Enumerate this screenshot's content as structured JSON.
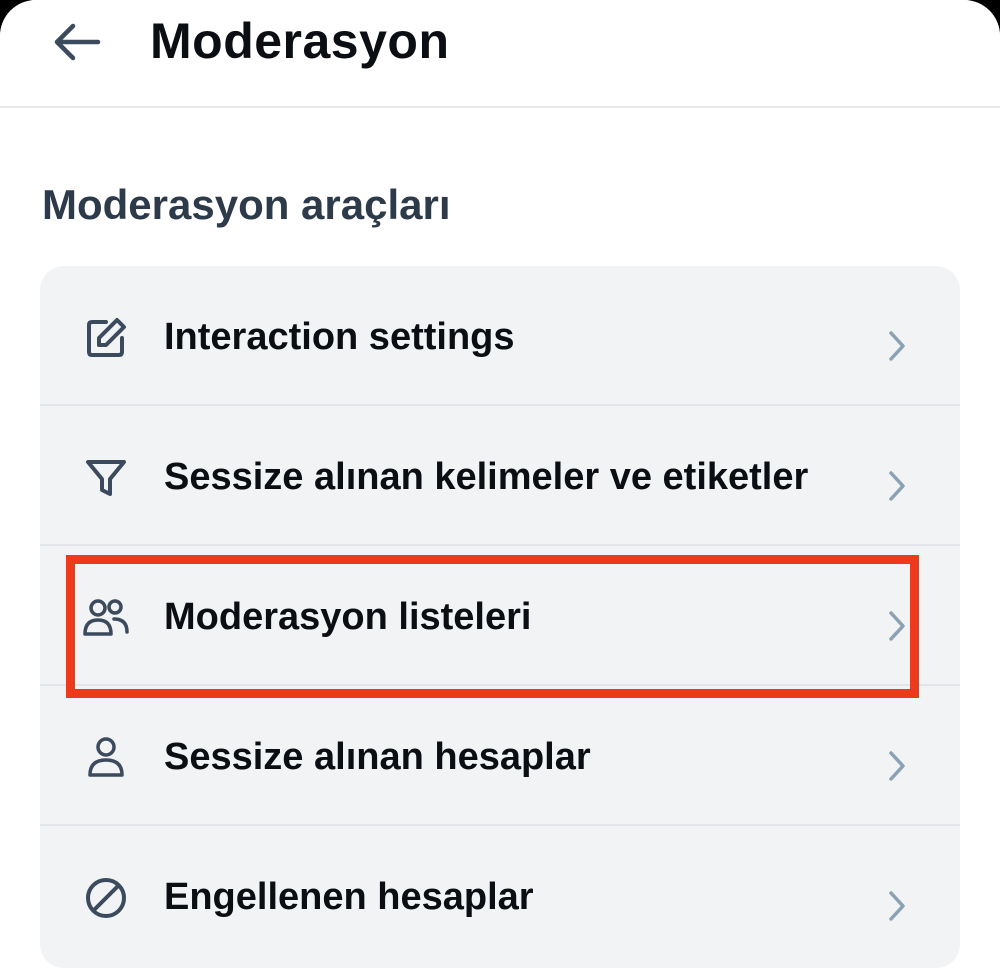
{
  "header": {
    "title": "Moderasyon",
    "back_icon": "arrow-left-icon"
  },
  "section": {
    "title": "Moderasyon araçları"
  },
  "items": [
    {
      "label": "Interaction settings",
      "icon": "edit-square-icon"
    },
    {
      "label": "Sessize alınan kelimeler ve etiketler",
      "icon": "filter-icon"
    },
    {
      "label": "Moderasyon listeleri",
      "icon": "users-icon"
    },
    {
      "label": "Sessize alınan hesaplar",
      "icon": "person-icon"
    },
    {
      "label": "Engellenen hesaplar",
      "icon": "block-icon"
    }
  ],
  "colors": {
    "highlight": "#ee3a1b",
    "card_background": "#f1f3f5",
    "section_title": "#2d3a4a",
    "icon": "#3b4a5c",
    "chevron": "#8aa0b4"
  }
}
